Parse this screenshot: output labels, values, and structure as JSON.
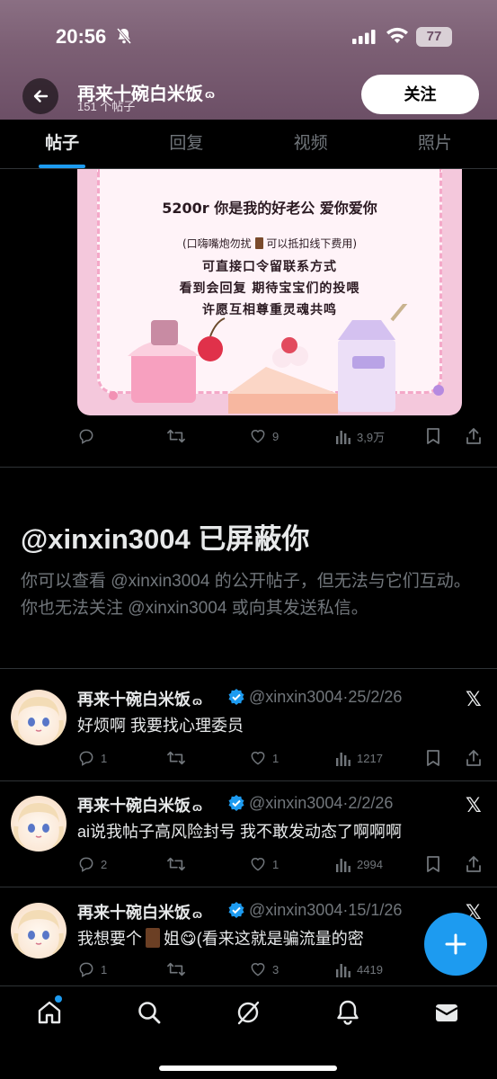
{
  "status": {
    "time": "20:56",
    "battery": "77"
  },
  "header": {
    "name": "再来十碗白米饭",
    "posts_count": "151 个帖子",
    "follow_label": "关注"
  },
  "tabs": [
    {
      "label": "帖子",
      "active": true
    },
    {
      "label": "回复",
      "active": false
    },
    {
      "label": "视频",
      "active": false
    },
    {
      "label": "照片",
      "active": false
    }
  ],
  "pinned_image_text": {
    "line1": "5200r 你是我的好老公 爱你爱你",
    "line2a": "(口嗨嘴炮勿扰 ",
    "line2b": " 可以抵扣线下费用)",
    "line3": "可直接口令留联系方式",
    "line4": "看到会回复 期待宝宝们的投喂",
    "line5": "许愿互相尊重灵魂共鸣"
  },
  "pinned_actions": {
    "replies": "",
    "retweets": "",
    "likes": "9",
    "views": "3,9万"
  },
  "blocked": {
    "title": "@xinxin3004 已屏蔽你",
    "description": "你可以查看 @xinxin3004 的公开帖子，但无法与它们互动。你也无法关注 @xinxin3004 或向其发送私信。"
  },
  "tweets": [
    {
      "name": "再来十碗白米饭",
      "handle": "@xinxin3004·25/2/26",
      "text": "好烦啊 我要找心理委员",
      "replies": "1",
      "retweets": "",
      "likes": "1",
      "views": "1217"
    },
    {
      "name": "再来十碗白米饭",
      "handle": "@xinxin3004·2/2/26",
      "text": "ai说我帖子高风险封号 我不敢发动态了啊啊啊",
      "replies": "2",
      "retweets": "",
      "likes": "1",
      "views": "2994"
    },
    {
      "name": "再来十碗白米饭",
      "handle": "@xinxin3004·15/1/26",
      "text_a": "我想要个",
      "text_b": "姐😋(看来这就是骗流量的密",
      "replies": "1",
      "retweets": "",
      "likes": "3",
      "views": "4419"
    }
  ],
  "colors": {
    "accent": "#1d9bf0",
    "muted": "#71767b",
    "banner": "#7c5f74"
  },
  "icons": [
    "back-arrow-icon",
    "home-icon",
    "search-icon",
    "grok-icon",
    "notifications-icon",
    "messages-icon",
    "compose-icon",
    "x-logo-icon",
    "verified-icon"
  ]
}
